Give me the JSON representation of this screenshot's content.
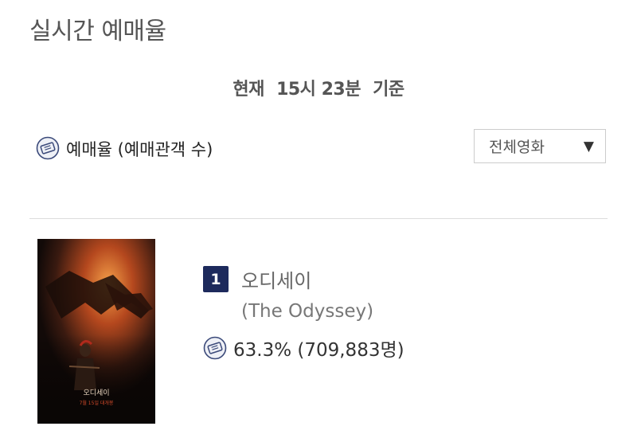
{
  "header": {
    "title": "실시간 예매율"
  },
  "basis": {
    "label": "현재",
    "time": "15시 23분",
    "suffix": "기준"
  },
  "metric": {
    "label": "예매율 (예매관객 수)",
    "icon": "ticket-icon"
  },
  "filter": {
    "selected": "전체영화",
    "arrow": "▼"
  },
  "ranking": [
    {
      "rank": "1",
      "title": "오디세이",
      "original_title": "(The Odyssey)",
      "rate": "63.3% (709,883명)",
      "poster_title": "오디세이",
      "poster_tagline": "7월 15일 대개봉"
    }
  ],
  "colors": {
    "rank_badge": "#1d2a5c",
    "icon": "#3b4a7a",
    "divider": "#dddddd"
  }
}
